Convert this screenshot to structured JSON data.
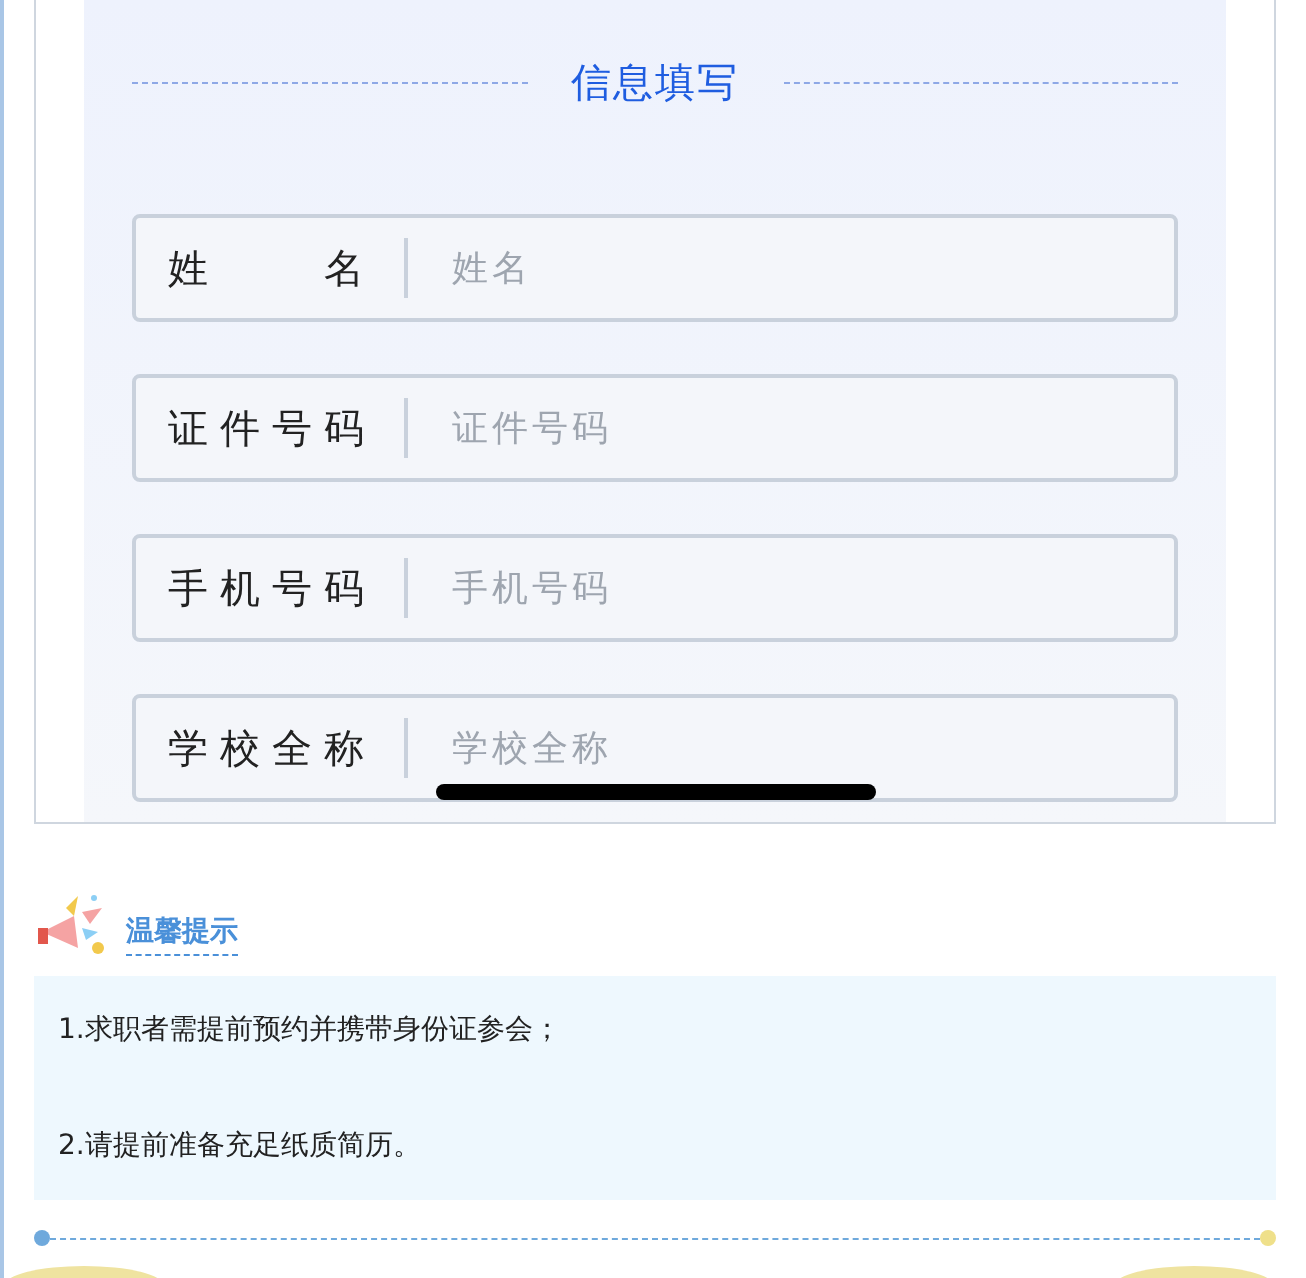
{
  "form": {
    "title": "信息填写",
    "fields": [
      {
        "label": "姓名",
        "placeholder": "姓名"
      },
      {
        "label": "证件号码",
        "placeholder": "证件号码"
      },
      {
        "label": "手机号码",
        "placeholder": "手机号码"
      },
      {
        "label": "学校全称",
        "placeholder": "学校全称"
      }
    ]
  },
  "tips": {
    "title": "温馨提示",
    "lines": [
      "1.求职者需提前预约并携带身份证参会；",
      "2.请提前准备充足纸质简历。"
    ]
  }
}
